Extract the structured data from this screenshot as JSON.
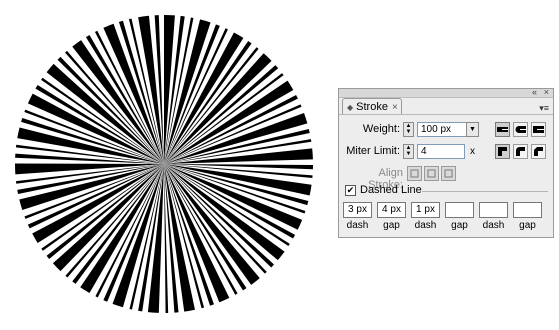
{
  "panel": {
    "tab_label": "Stroke",
    "tab_close": "×",
    "topbar_collapse": "«",
    "topbar_close": "×",
    "menu_icon": "panel-menu-icon"
  },
  "weight": {
    "label": "Weight:",
    "value": "100 px"
  },
  "miter": {
    "label": "Miter Limit:",
    "value": "4",
    "unit": "x"
  },
  "align_stroke": {
    "label": "Align Stroke:"
  },
  "dashed_line": {
    "label": "Dashed Line",
    "checked": "✔"
  },
  "dash_values": [
    {
      "value": "3 px",
      "caption": "dash"
    },
    {
      "value": "4 px",
      "caption": "gap"
    },
    {
      "value": "1 px",
      "caption": "dash"
    },
    {
      "value": "",
      "caption": "gap"
    },
    {
      "value": "",
      "caption": "dash"
    },
    {
      "value": "",
      "caption": "gap"
    }
  ],
  "colors": {
    "burst": "#000000",
    "panel_bg": "#ededed",
    "field_border": "#7f9db9"
  }
}
